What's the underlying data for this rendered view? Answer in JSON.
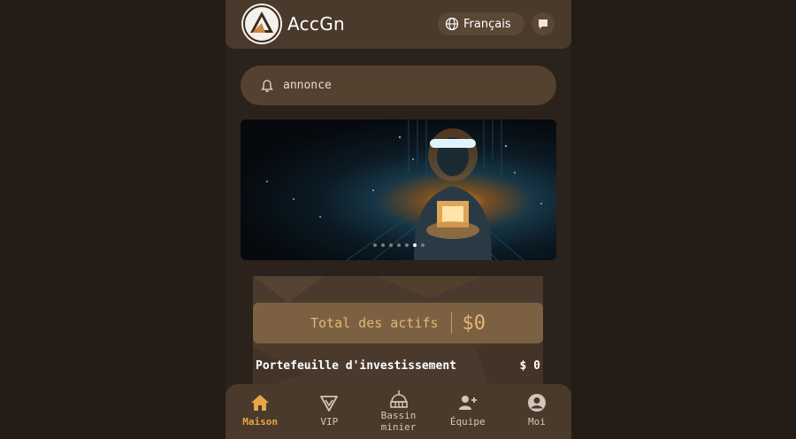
{
  "header": {
    "brand": "AccGn",
    "language": "Français",
    "icons": {
      "logo": "accgn-logo",
      "language": "globe-icon",
      "chat": "chat-icon"
    }
  },
  "notice": {
    "text": "annonce",
    "icon": "bell-icon"
  },
  "banner": {
    "slide_count": 7,
    "active_index": 5
  },
  "assets": {
    "total_label": "Total des actifs",
    "total_value": "$0",
    "wallet_label": "Portefeuille d'investissement",
    "wallet_value": "$ 0"
  },
  "tabbar": {
    "items": [
      {
        "label": "Maison",
        "icon": "home-icon",
        "active": true
      },
      {
        "label": "VIP",
        "icon": "vip-icon",
        "active": false
      },
      {
        "label": "Bassin minier",
        "icon": "mining-pool-icon",
        "active": false
      },
      {
        "label": "Équipe",
        "icon": "team-icon",
        "active": false
      },
      {
        "label": "Moi",
        "icon": "user-icon",
        "active": false
      }
    ]
  },
  "colors": {
    "accent": "#e6a64a",
    "background": "#241c17",
    "panel": "#4a3a2b"
  }
}
